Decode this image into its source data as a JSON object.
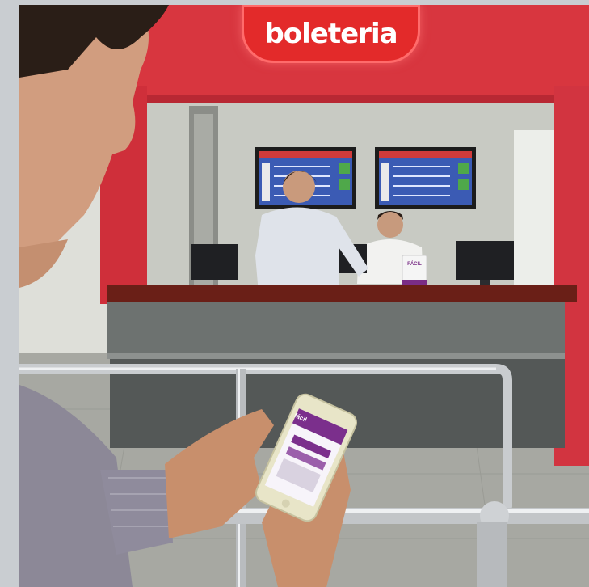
{
  "sign": {
    "text": "boleteria",
    "color": "#e32a2a"
  },
  "counter_card": {
    "text": "FÁCIL"
  },
  "phone": {
    "app_label": "fácil"
  },
  "colors": {
    "wall_red": "#d8363f",
    "back_wall": "#c7c9c2",
    "counter_wood": "#6a1f17",
    "counter_stone": "#5e6362",
    "floor": "#a9aaa4",
    "railing": "#c9cccf",
    "screen": "#3b5bb4"
  }
}
